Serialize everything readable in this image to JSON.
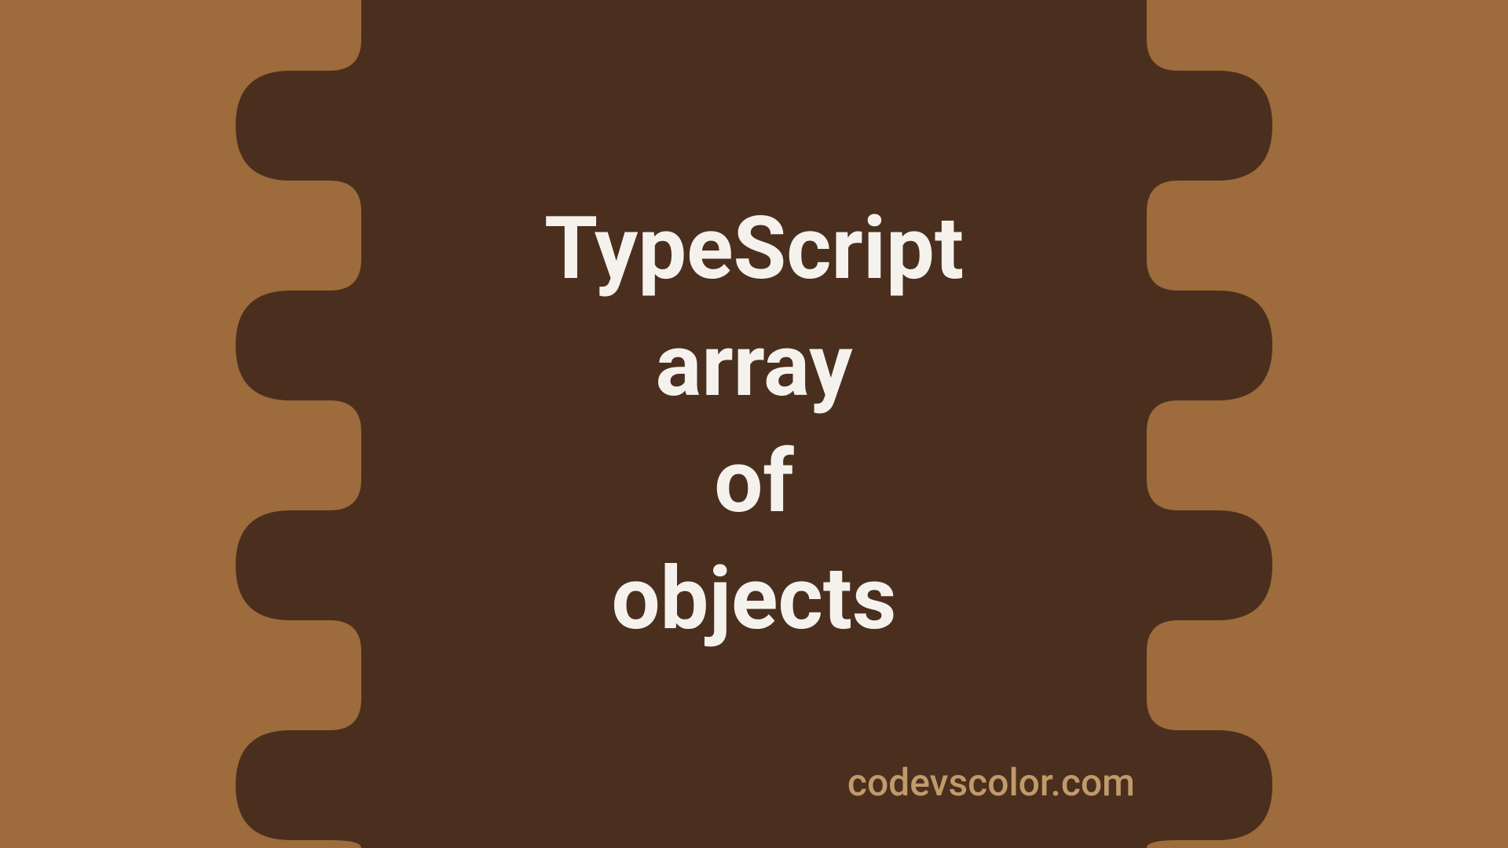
{
  "title": {
    "line1": "TypeScript",
    "line2": "array",
    "line3": "of",
    "line4": "objects"
  },
  "footer": "codevscolor.com",
  "colors": {
    "background": "#9d6b3c",
    "blob": "#4a2f1e",
    "titleText": "#f5f2ee",
    "footerText": "#c19a6b"
  }
}
